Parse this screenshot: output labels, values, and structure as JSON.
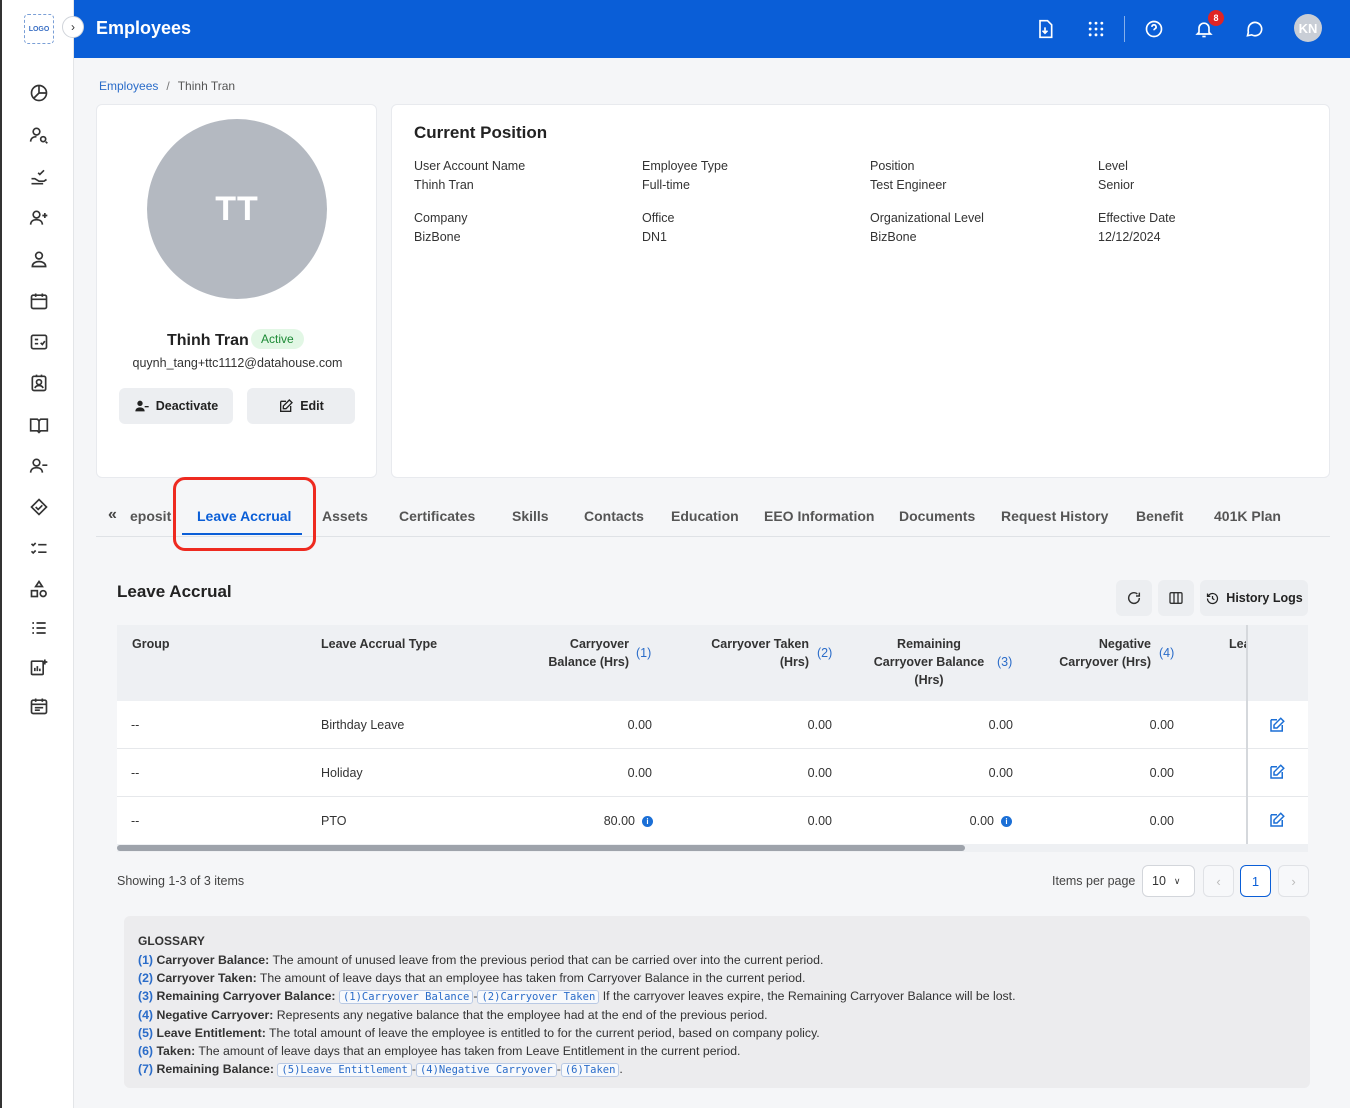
{
  "app": {
    "logo_text": "LOGO",
    "title": "Employees",
    "notification_count": "8",
    "user_initials": "KN"
  },
  "breadcrumb": {
    "parent": "Employees",
    "current": "Thinh Tran"
  },
  "profile": {
    "initials": "TT",
    "name": "Thinh Tran",
    "status": "Active",
    "email": "quynh_tang+ttc1112@datahouse.com",
    "deactivate_label": "Deactivate",
    "edit_label": "Edit"
  },
  "position": {
    "title": "Current Position",
    "fields": [
      {
        "label": "User Account Name",
        "value": "Thinh Tran"
      },
      {
        "label": "Employee Type",
        "value": "Full-time"
      },
      {
        "label": "Position",
        "value": "Test Engineer"
      },
      {
        "label": "Level",
        "value": "Senior"
      },
      {
        "label": "Company",
        "value": "BizBone"
      },
      {
        "label": "Office",
        "value": "DN1"
      },
      {
        "label": "Organizational Level",
        "value": "BizBone"
      },
      {
        "label": "Effective Date",
        "value": "12/12/2024"
      }
    ]
  },
  "tabs": [
    "eposit",
    "Leave Accrual",
    "Assets",
    "Certificates",
    "Skills",
    "Contacts",
    "Education",
    "EEO Information",
    "Documents",
    "Request History",
    "Benefit",
    "401K Plan"
  ],
  "leave": {
    "title": "Leave Accrual",
    "history_label": "History Logs",
    "columns": {
      "group": "Group",
      "type": "Leave Accrual Type",
      "cb1": "Carryover",
      "cb2": "Balance (Hrs)",
      "cb_n": "(1)",
      "ct1": "Carryover Taken",
      "ct2": "(Hrs)",
      "ct_n": "(2)",
      "rc1": "Remaining",
      "rc2": "Carryover Balance",
      "rc3": "(Hrs)",
      "rc_n": "(3)",
      "nc1": "Negative",
      "nc2": "Carryover (Hrs)",
      "nc_n": "(4)",
      "le": "Lea"
    },
    "rows": [
      {
        "group": "--",
        "type": "Birthday Leave",
        "cb": "0.00",
        "ct": "0.00",
        "rc": "0.00",
        "nc": "0.00"
      },
      {
        "group": "--",
        "type": "Holiday",
        "cb": "0.00",
        "ct": "0.00",
        "rc": "0.00",
        "nc": "0.00"
      },
      {
        "group": "--",
        "type": "PTO",
        "cb": "80.00",
        "ct": "0.00",
        "rc": "0.00",
        "nc": "0.00"
      }
    ],
    "showing": "Showing 1-3 of 3 items",
    "items_per_page_label": "Items per page",
    "items_per_page": "10",
    "current_page": "1"
  },
  "glossary": {
    "title": "GLOSSARY",
    "items": [
      {
        "n": "(1)",
        "k": "Carryover Balance:",
        "t": "The amount of unused leave from the previous period that can be carried over into the current period."
      },
      {
        "n": "(2)",
        "k": "Carryover Taken:",
        "t": "The amount of leave days that an employee has taken from Carryover Balance in the current period."
      },
      {
        "n": "(3)",
        "k": "Remaining Carryover Balance:",
        "c1": "(1)Carryover Balance",
        "op": "-",
        "c2": "(2)Carryover Taken",
        "t": "If the carryover leaves expire, the Remaining Carryover Balance will be lost."
      },
      {
        "n": "(4)",
        "k": "Negative Carryover:",
        "t": "Represents any negative balance that the employee had at the end of the previous period."
      },
      {
        "n": "(5)",
        "k": "Leave Entitlement:",
        "t": "The total amount of leave the employee is entitled to for the current period, based on company policy."
      },
      {
        "n": "(6)",
        "k": "Taken:",
        "t": "The amount of leave days that an employee has taken from Leave Entitlement in the current period."
      },
      {
        "n": "(7)",
        "k": "Remaining Balance:",
        "c1": "(5)Leave Entitlement",
        "op": "-",
        "c2": "(4)Negative Carryover",
        "op2": "-",
        "c3": "(6)Taken",
        "end": "."
      }
    ]
  }
}
